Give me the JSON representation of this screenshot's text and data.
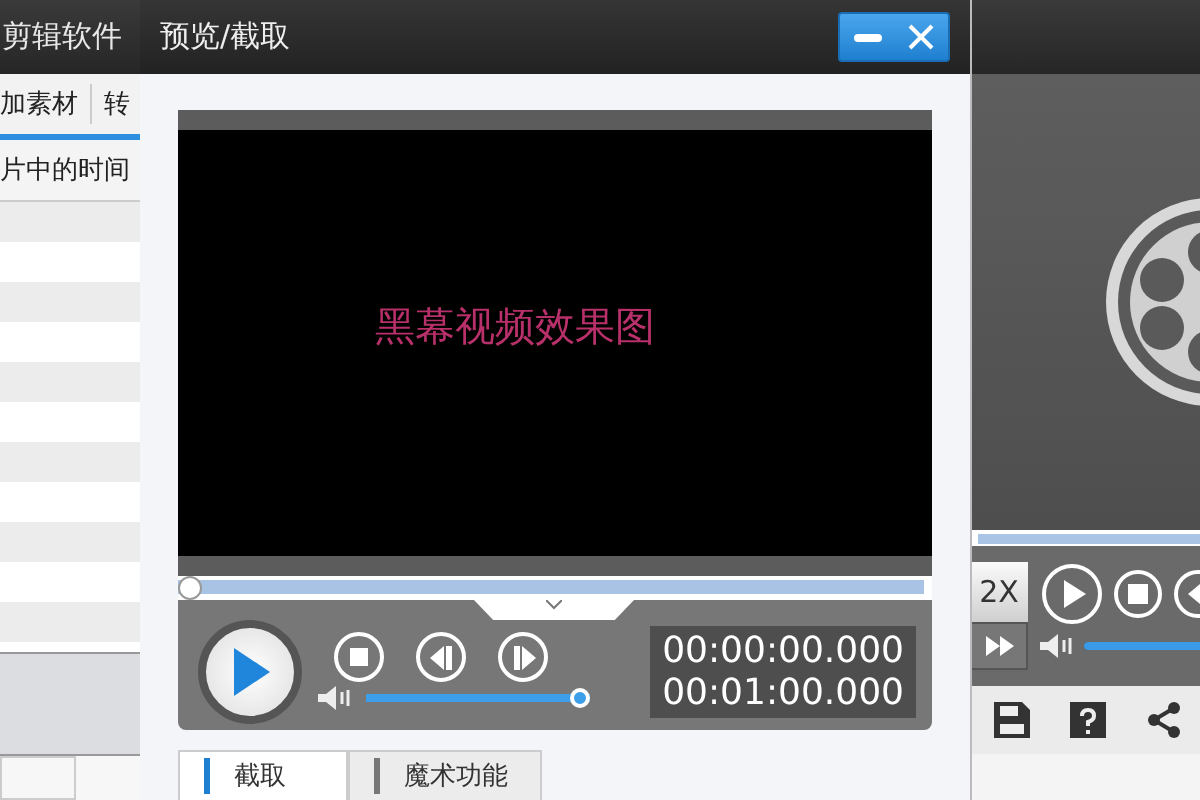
{
  "background_window": {
    "title": "剪辑软件",
    "toolbar": [
      "加素材",
      "转"
    ],
    "column_header": "片中的时间",
    "player": {
      "progress": {
        "level": 1
      },
      "speed": "2X",
      "volume": {
        "level": 1
      }
    }
  },
  "dialog": {
    "title": "预览/截取",
    "video_caption": "黑幕视频效果图",
    "progress": {
      "level": 0
    },
    "volume": {
      "level": 1
    },
    "current_time": "00:00:00.000",
    "total_time": "00:01:00.000",
    "tabs": [
      {
        "label": "截取",
        "selected": true
      },
      {
        "label": "魔术功能",
        "selected": false
      }
    ]
  }
}
